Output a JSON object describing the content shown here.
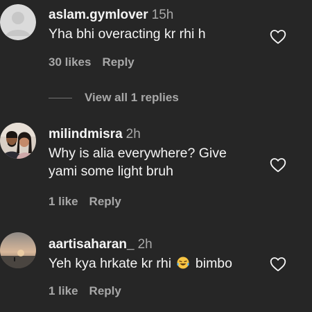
{
  "colors": {
    "background": "#262626",
    "primary_text": "#f5f5f5",
    "secondary_text": "#a8a8a8"
  },
  "comments": [
    {
      "username": "aslam.gymlover",
      "time": "15h",
      "text": "Yha bhi overacting kr rhi h",
      "likes": "30 likes",
      "reply": "Reply",
      "avatar": "default-avatar-icon",
      "view_replies": "View all 1 replies"
    },
    {
      "username": "milindmisra",
      "time": "2h",
      "text": "Why is alia everywhere? Give yami some light bruh",
      "likes": "1 like",
      "reply": "Reply",
      "avatar": "couple-photo"
    },
    {
      "username": "aartisaharan_",
      "time": "2h",
      "text_before": "Yeh kya hrkate kr rhi",
      "text_emoji": "laughing-crying-face-icon",
      "text_after": "bimbo",
      "likes": "1 like",
      "reply": "Reply",
      "avatar": "sunset-photo"
    }
  ]
}
